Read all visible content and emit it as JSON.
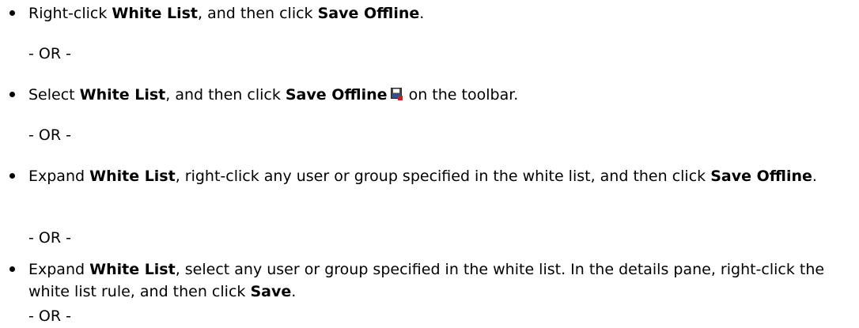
{
  "steps": [
    {
      "p1": "Right-click ",
      "b1": "White List",
      "p2": ", and then click ",
      "b2": "Save Offline",
      "p3": "."
    },
    {
      "p1": "Select ",
      "b1": "White List",
      "p2": ", and then click ",
      "b2": "Save Offline",
      "p3": " on the toolbar.",
      "icon": "save-offline-icon"
    },
    {
      "p1": "Expand ",
      "b1": "White List",
      "p2": ", right-click any user or group specified in the white list, and then click ",
      "b2": "Save Offline",
      "p3": "."
    },
    {
      "p1": "Expand ",
      "b1": "White List",
      "p2": ", select any user or group specified in the white list. In the details pane, right-click the white list rule, and then click ",
      "b2": "Save",
      "p3": "."
    }
  ],
  "separators": [
    "- OR -",
    "- OR -",
    "- OR -",
    "- OR -"
  ],
  "colors": {
    "text": "#000000",
    "icon_red": "#cc1f1f",
    "icon_blue": "#2b4fa8"
  }
}
